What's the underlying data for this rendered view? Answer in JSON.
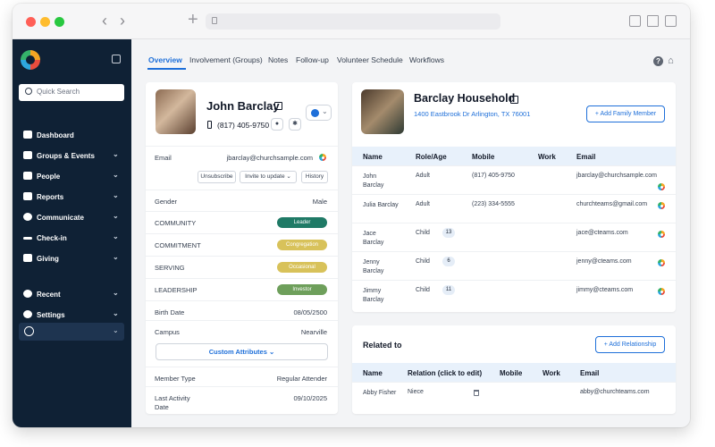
{
  "sidebar": {
    "search_placeholder": "Quick Search",
    "items": [
      {
        "label": "Dashboard",
        "icon": "home-icon",
        "chevron": false
      },
      {
        "label": "Groups & Events",
        "icon": "groups-icon",
        "chevron": true
      },
      {
        "label": "People",
        "icon": "person-icon",
        "chevron": true
      },
      {
        "label": "Reports",
        "icon": "reports-icon",
        "chevron": true
      },
      {
        "label": "Communicate",
        "icon": "chat-icon",
        "chevron": true
      },
      {
        "label": "Check-in",
        "icon": "checkin-icon",
        "chevron": true
      },
      {
        "label": "Giving",
        "icon": "giving-icon",
        "chevron": true
      },
      {
        "label": "Recent",
        "icon": "clock-icon",
        "chevron": true
      },
      {
        "label": "Settings",
        "icon": "gear-icon",
        "chevron": true
      }
    ]
  },
  "tabs": [
    "Overview",
    "Involvement (Groups)",
    "Notes",
    "Follow-up",
    "Volunteer Schedule",
    "Workflows"
  ],
  "person": {
    "name": "John Barclay",
    "phone": "(817) 405-9750",
    "email_label": "Email",
    "email": "jbarclay@churchsample.com",
    "actions": [
      "Unsubscribe",
      "Invite to update ⌄",
      "History"
    ],
    "gender_label": "Gender",
    "gender": "Male",
    "statuses": [
      {
        "label": "COMMUNITY",
        "value": "Leader",
        "color": "#1f7a66"
      },
      {
        "label": "COMMITMENT",
        "value": "Congregation",
        "color": "#d8c25a"
      },
      {
        "label": "SERVING",
        "value": "Occasional",
        "color": "#d8c25a"
      },
      {
        "label": "LEADERSHIP",
        "value": "Investor",
        "color": "#6e9f5b"
      }
    ],
    "birth_label": "Birth Date",
    "birth": "08/05/2500",
    "campus_label": "Campus",
    "campus": "Nearville",
    "custom_attr": "Custom Attributes ⌄",
    "member_type_label": "Member Type",
    "member_type": "Regular Attender",
    "last_activity_label": "Last Activity Date",
    "last_activity": "09/10/2025"
  },
  "household": {
    "title": "Barclay Household",
    "address": "1400 Eastbrook Dr Arlington, TX 76001",
    "add_button": "+ Add Family Member",
    "headers": [
      "Name",
      "Role/Age",
      "Mobile",
      "Work",
      "Email"
    ],
    "members": [
      {
        "name": "John Barclay",
        "role": "Adult",
        "age": "",
        "mobile": "(817) 405-9750",
        "work": "",
        "email": "jbarclay@churchsample.com"
      },
      {
        "name": "Julia Barclay",
        "role": "Adult",
        "age": "",
        "mobile": "(223) 334-5555",
        "work": "",
        "email": "churchteams@gmail.com"
      },
      {
        "name": "Jace Barclay",
        "role": "Child",
        "age": "13",
        "mobile": "",
        "work": "",
        "email": "jace@cteams.com"
      },
      {
        "name": "Jenny Barclay",
        "role": "Child",
        "age": "6",
        "mobile": "",
        "work": "",
        "email": "jenny@cteams.com"
      },
      {
        "name": "Jimmy Barclay",
        "role": "Child",
        "age": "11",
        "mobile": "",
        "work": "",
        "email": "jimmy@cteams.com"
      }
    ]
  },
  "related": {
    "title": "Related to",
    "add_button": "+ Add Relationship",
    "headers": [
      "Name",
      "Relation (click to edit)",
      "Mobile",
      "Work",
      "Email"
    ],
    "rows": [
      {
        "name": "Abby Fisher",
        "relation": "Niece",
        "mobile": "",
        "work": "",
        "email": "abby@churchteams.com"
      }
    ]
  }
}
